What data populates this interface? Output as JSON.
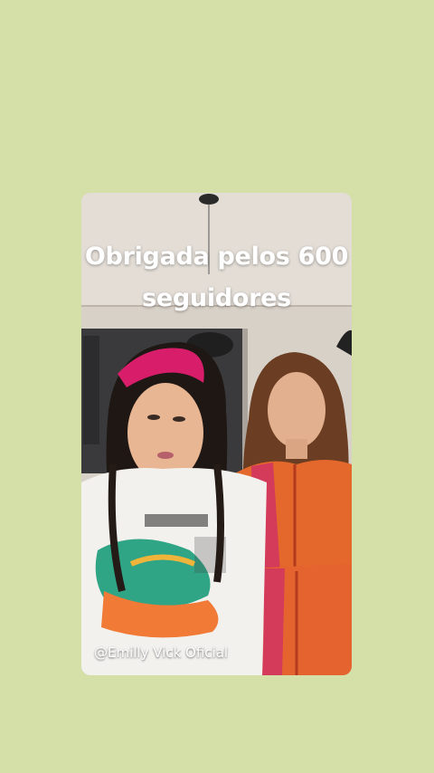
{
  "story": {
    "caption_line1": "Obrigada pelos 600",
    "caption_line2": "seguidores",
    "watermark": "@Emilly Vick Oficial"
  },
  "colors": {
    "background": "#d5e0a9",
    "caption_text": "#ffffff"
  }
}
